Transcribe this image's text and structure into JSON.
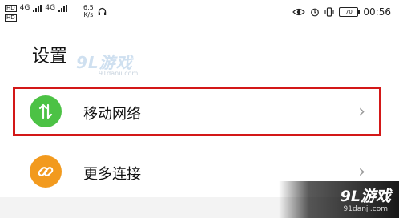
{
  "status_bar": {
    "sim1_label": "HD",
    "sim1_network": "4G",
    "sim2_label": "HD",
    "sim2_network": "4G",
    "speed_value": "6.5",
    "speed_unit": "K/s",
    "battery": "70",
    "time": "00:56"
  },
  "header": {
    "title": "设置"
  },
  "watermark": {
    "top_text": "9L游戏",
    "top_url": "91danji.com",
    "corner_text": "9L游戏",
    "corner_url": "91danji.com"
  },
  "settings": {
    "items": [
      {
        "label": "移动网络",
        "icon": "arrows-updown-icon",
        "color": "#4cc245"
      },
      {
        "label": "更多连接",
        "icon": "link-icon",
        "color": "#f29a1e"
      }
    ]
  },
  "highlight_color": "#d31818"
}
